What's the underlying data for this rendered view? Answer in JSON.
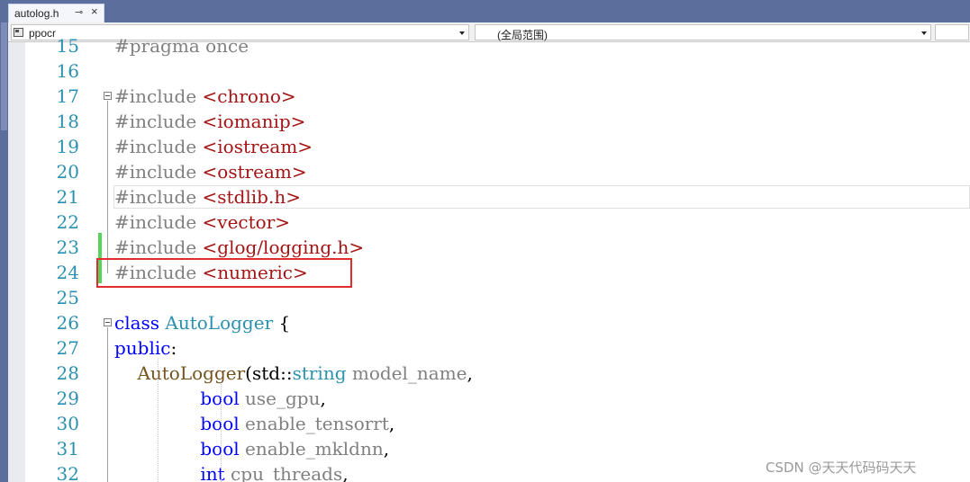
{
  "tab": {
    "filename": "autolog.h",
    "pin_glyph": "⊸",
    "close_glyph": "×"
  },
  "navbar": {
    "project": "ppocr",
    "scope": "(全局范围)"
  },
  "editor": {
    "lines": [
      {
        "num": "15",
        "tokens": [
          {
            "t": "#pragma once",
            "c": "pp"
          }
        ]
      },
      {
        "num": "16",
        "tokens": []
      },
      {
        "num": "17",
        "tokens": [
          {
            "t": "#include ",
            "c": "pp"
          },
          {
            "t": "<chrono>",
            "c": "str"
          }
        ]
      },
      {
        "num": "18",
        "tokens": [
          {
            "t": "#include ",
            "c": "pp"
          },
          {
            "t": "<iomanip>",
            "c": "str"
          }
        ]
      },
      {
        "num": "19",
        "tokens": [
          {
            "t": "#include ",
            "c": "pp"
          },
          {
            "t": "<iostream>",
            "c": "str"
          }
        ]
      },
      {
        "num": "20",
        "tokens": [
          {
            "t": "#include ",
            "c": "pp"
          },
          {
            "t": "<ostream>",
            "c": "str"
          }
        ]
      },
      {
        "num": "21",
        "tokens": [
          {
            "t": "#include ",
            "c": "pp"
          },
          {
            "t": "<stdlib.h>",
            "c": "str"
          }
        ]
      },
      {
        "num": "22",
        "tokens": [
          {
            "t": "#include ",
            "c": "pp"
          },
          {
            "t": "<vector>",
            "c": "str"
          }
        ]
      },
      {
        "num": "23",
        "tokens": [
          {
            "t": "#include ",
            "c": "pp"
          },
          {
            "t": "<glog/logging.h>",
            "c": "str"
          }
        ]
      },
      {
        "num": "24",
        "tokens": [
          {
            "t": "#include ",
            "c": "pp"
          },
          {
            "t": "<numeric>",
            "c": "str"
          }
        ]
      },
      {
        "num": "25",
        "tokens": []
      },
      {
        "num": "26",
        "tokens": [
          {
            "t": "class ",
            "c": "kw"
          },
          {
            "t": "AutoLogger",
            "c": "ty"
          },
          {
            "t": " {",
            "c": ""
          }
        ]
      },
      {
        "num": "27",
        "tokens": [
          {
            "t": "public",
            "c": "kw"
          },
          {
            "t": ":",
            "c": ""
          }
        ]
      },
      {
        "num": "28",
        "tokens": [
          {
            "t": "    ",
            "c": ""
          },
          {
            "t": "AutoLogger",
            "c": "fn"
          },
          {
            "t": "(std::",
            "c": ""
          },
          {
            "t": "string",
            "c": "ty"
          },
          {
            "t": " model_name",
            "c": "pm"
          },
          {
            "t": ",",
            "c": ""
          }
        ]
      },
      {
        "num": "29",
        "tokens": [
          {
            "t": "               ",
            "c": ""
          },
          {
            "t": "bool",
            "c": "kw"
          },
          {
            "t": " use_gpu",
            "c": "pm"
          },
          {
            "t": ",",
            "c": ""
          }
        ]
      },
      {
        "num": "30",
        "tokens": [
          {
            "t": "               ",
            "c": ""
          },
          {
            "t": "bool",
            "c": "kw"
          },
          {
            "t": " enable_tensorrt",
            "c": "pm"
          },
          {
            "t": ",",
            "c": ""
          }
        ]
      },
      {
        "num": "31",
        "tokens": [
          {
            "t": "               ",
            "c": ""
          },
          {
            "t": "bool",
            "c": "kw"
          },
          {
            "t": " enable_mkldnn",
            "c": "pm"
          },
          {
            "t": ",",
            "c": ""
          }
        ]
      },
      {
        "num": "32",
        "tokens": [
          {
            "t": "               ",
            "c": ""
          },
          {
            "t": "int",
            "c": "kw"
          },
          {
            "t": " cpu_threads",
            "c": "pm"
          },
          {
            "t": ",",
            "c": ""
          }
        ]
      }
    ]
  },
  "watermark": "CSDN @天天代码码天天",
  "colors": {
    "line_number": "#2b91af",
    "preprocessor": "#808080",
    "string": "#a31515",
    "keyword": "#0000ff",
    "type": "#2b91af",
    "function": "#74531f",
    "change_bar": "#57d25a",
    "highlight_box": "#e02c2c",
    "tabbar_bg": "#5b6f9d"
  }
}
